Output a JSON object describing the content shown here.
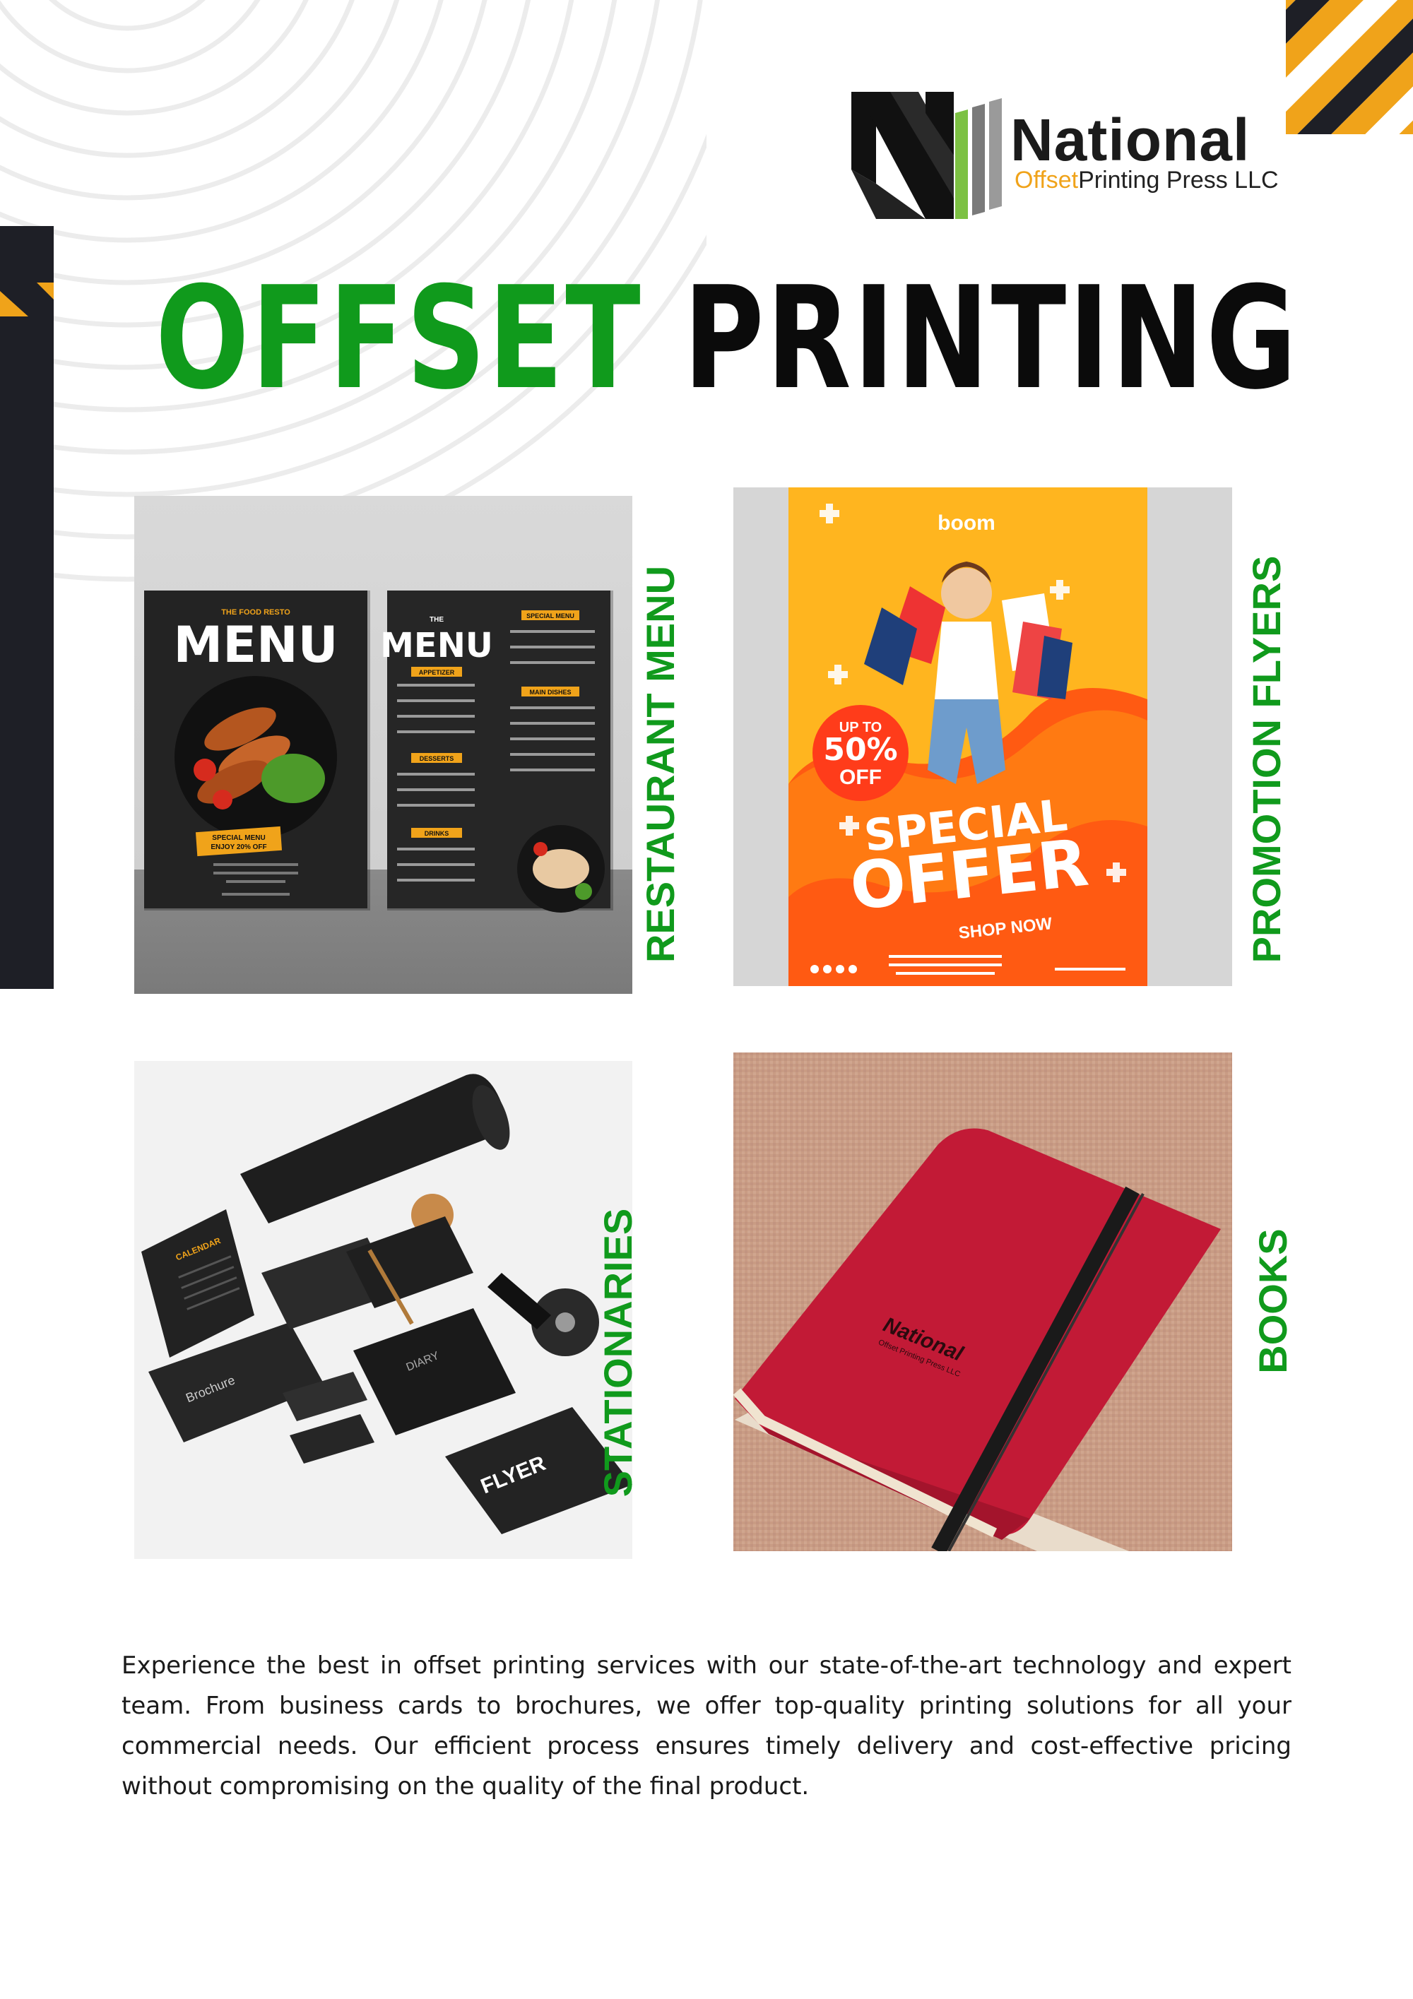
{
  "brand": {
    "name": "National",
    "sub_offset": "Offset",
    "sub_rest": "Printing Press LLC"
  },
  "title": {
    "word1": "OFFSET",
    "word2": "PRINTING"
  },
  "colors": {
    "green": "#109a1c",
    "dark": "#1e1f26",
    "yellow": "#f0a31a"
  },
  "products": [
    {
      "label": "RESTAURANT MENU",
      "menu_left": {
        "top": "THE FOOD RESTO",
        "big": "MENU",
        "promo1": "SPECIAL MENU",
        "promo2": "ENJOY 20% OFF"
      },
      "menu_right": {
        "top": "THE",
        "big": "MENU",
        "h1": "APPETIZER",
        "h2": "SPECIAL MENU",
        "h3": "MAIN DISHES",
        "h4": "DESSERTS",
        "h5": "DRINKS"
      }
    },
    {
      "label": "PROMOTION FLYERS",
      "flyer": {
        "brand": "boom",
        "upto": "UP TO",
        "pct": "50%",
        "off": "OFF",
        "special": "SPECIAL",
        "offer": "OFFER",
        "shop": "SHOP NOW"
      }
    },
    {
      "label": "STATIONARIES",
      "items": {
        "calendar": "CALENDAR",
        "brochure": "Brochure",
        "diary": "DIARY",
        "flyer": "FLYER"
      }
    },
    {
      "label": "BOOKS",
      "book": {
        "brand": "National",
        "sub": "Offset Printing Press LLC"
      }
    }
  ],
  "description": "Experience the best in offset printing services with our state-of-the-art technology and expert team. From business cards to brochures, we offer top-quality printing solutions for all your commercial needs. Our efficient process ensures timely delivery and cost-effective pricing without compromising on the quality of the final product."
}
